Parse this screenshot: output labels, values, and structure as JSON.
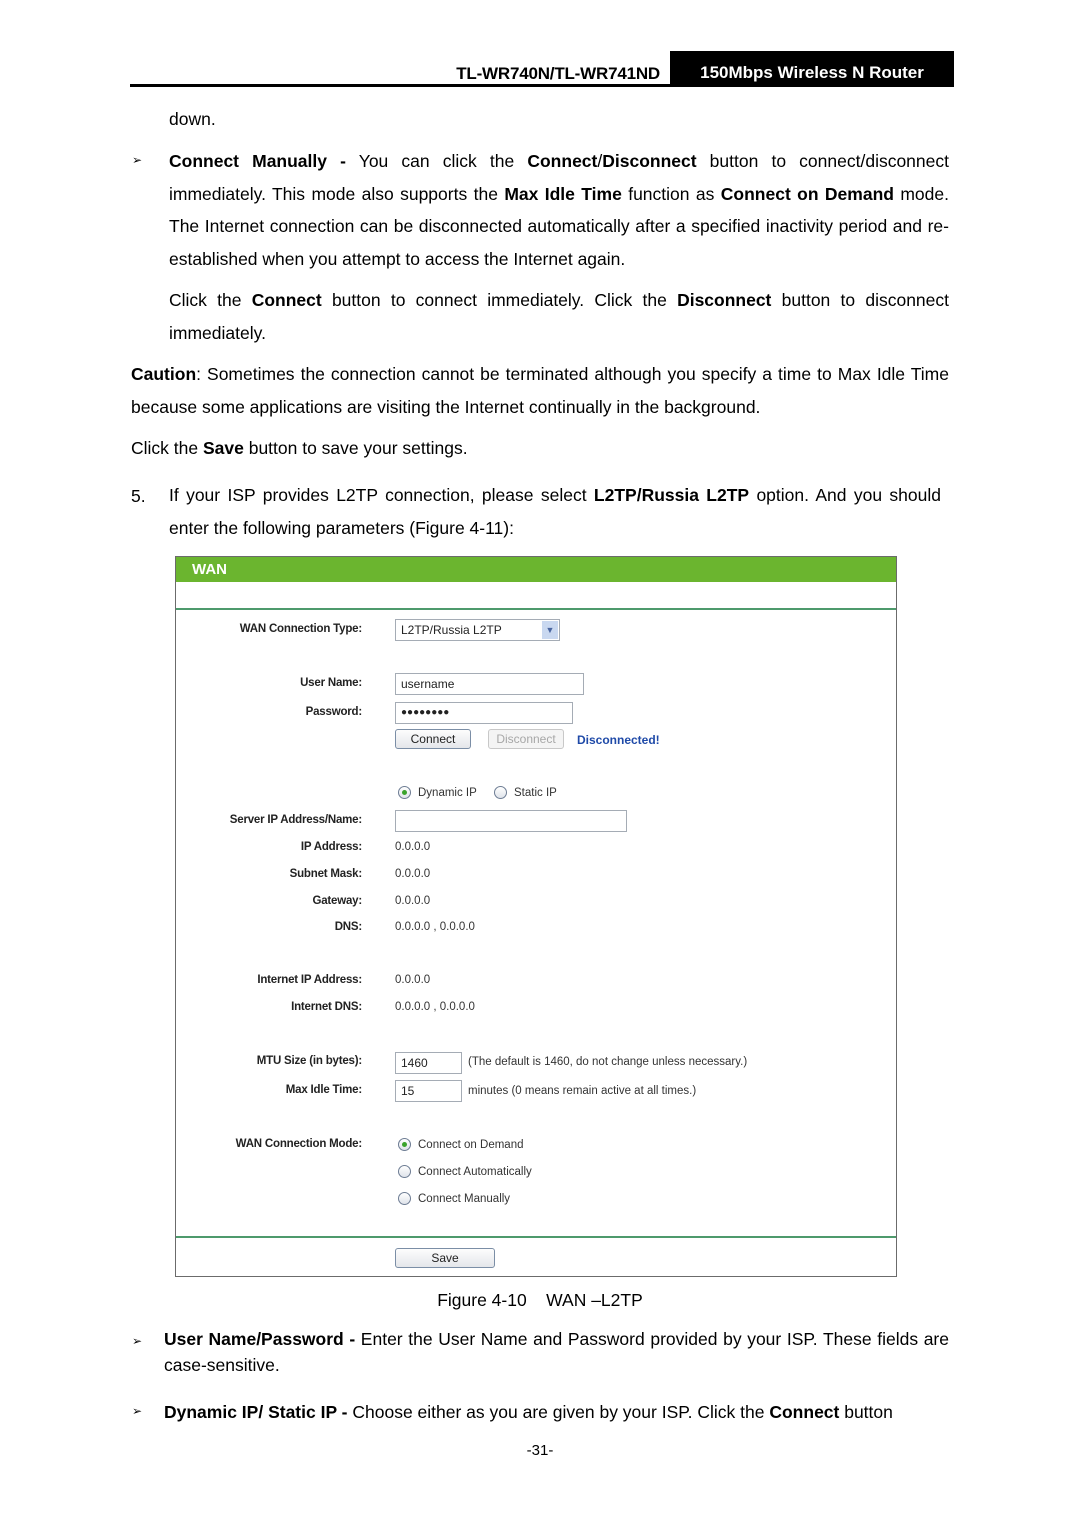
{
  "header": {
    "model": "TL-WR740N/TL-WR741ND",
    "product": "150Mbps Wireless N Router"
  },
  "body": {
    "p_down": "down.",
    "connect_manually": {
      "term": "Connect Manually -",
      "t1": " You can click the ",
      "b1": "Connect",
      "t2": "/",
      "b2": "Disconnect",
      "t3": " button to connect/disconnect immediately. This mode also supports the ",
      "b3": "Max Idle Time",
      "t4": " function as ",
      "b4": "Connect on Demand",
      "t5": " mode. The Internet connection can be disconnected automatically after a specified inactivity period and re-established when you attempt to access the Internet again."
    },
    "click_connect": {
      "t1": "Click the ",
      "b1": "Connect",
      "t2": " button to connect immediately. Click the ",
      "b2": "Disconnect",
      "t3": " button to disconnect immediately."
    },
    "caution": {
      "b1": "Caution",
      "t1": ": Sometimes the connection cannot be terminated although you specify a time to Max Idle Time because some applications are visiting the Internet continually in the background."
    },
    "save_note": {
      "t1": "Click the ",
      "b1": "Save",
      "t2": " button to save your settings."
    },
    "step5": {
      "num": "5.",
      "t1": "If your ISP provides L2TP connection, please select ",
      "b1": "L2TP/Russia L2TP",
      "t2": " option. And you should enter the following parameters (Figure 4-11):"
    },
    "bullet_glyph": "➢",
    "user_pass": {
      "term": "User Name/Password -",
      "t1": " Enter the User Name and Password provided by your ISP. These fields are case-sensitive."
    },
    "dynamic_static": {
      "term": "Dynamic IP/ Static IP -",
      "t1": " Choose either as you are given by your ISP. Click the ",
      "b1": "Connect",
      "t2": " button"
    }
  },
  "figure": {
    "title": "WAN",
    "accent_color": "#6bb52f",
    "wan_type": {
      "label": "WAN Connection Type:",
      "value": "L2TP/Russia L2TP"
    },
    "user_name": {
      "label": "User Name:",
      "value": "username"
    },
    "password": {
      "label": "Password:",
      "value": "●●●●●●●●"
    },
    "connect_btn": "Connect",
    "disconnect_btn": "Disconnect",
    "status": "Disconnected!",
    "ip_mode": {
      "options": [
        "Dynamic IP",
        "Static IP"
      ],
      "selected": "Dynamic IP"
    },
    "server": {
      "label": "Server IP Address/Name:",
      "value": ""
    },
    "ip_address": {
      "label": "IP Address:",
      "value": "0.0.0.0"
    },
    "subnet_mask": {
      "label": "Subnet Mask:",
      "value": "0.0.0.0"
    },
    "gateway": {
      "label": "Gateway:",
      "value": "0.0.0.0"
    },
    "dns": {
      "label": "DNS:",
      "value": "0.0.0.0 , 0.0.0.0"
    },
    "internet_ip": {
      "label": "Internet IP Address:",
      "value": "0.0.0.0"
    },
    "internet_dns": {
      "label": "Internet DNS:",
      "value": "0.0.0.0 , 0.0.0.0"
    },
    "mtu": {
      "label": "MTU Size (in bytes):",
      "value": "1460",
      "hint": "(The default is 1460, do not change unless necessary.)"
    },
    "max_idle": {
      "label": "Max Idle Time:",
      "value": "15",
      "hint": "minutes (0 means remain active at all times.)"
    },
    "conn_mode": {
      "label": "WAN Connection Mode:",
      "options": [
        "Connect on Demand",
        "Connect Automatically",
        "Connect Manually"
      ],
      "selected": "Connect on Demand"
    },
    "save_btn": "Save"
  },
  "caption": "Figure 4-10    WAN –L2TP",
  "page_number": "-31-"
}
